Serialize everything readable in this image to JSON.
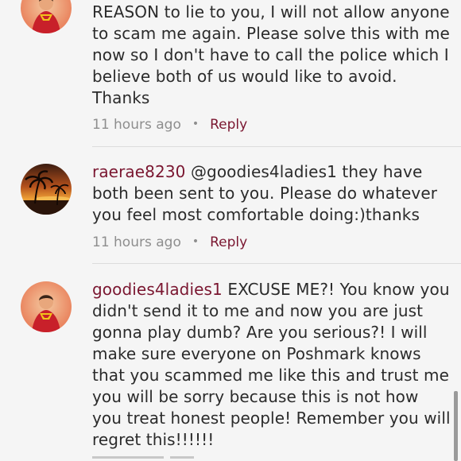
{
  "comments": [
    {
      "username": "",
      "text": "REASON to lie to you, I will not allow anyone to scam me again. Please solve this with me now so I don't have to call the police which I believe both of us would like to avoid. Thanks",
      "time": "11 hours ago",
      "reply_label": "Reply",
      "avatar_icon": "superman-avatar-icon"
    },
    {
      "username": "raerae8230",
      "text": "@goodies4ladies1 they have both been sent to you.  Please do whatever you feel most comfortable doing:)thanks",
      "time": "11 hours ago",
      "reply_label": "Reply",
      "avatar_icon": "sunset-palm-avatar-icon"
    },
    {
      "username": "goodies4ladies1",
      "text": "EXCUSE ME?! You know you didn't send it to me and now you are just gonna play dumb? Are you serious?! I will make sure everyone on Poshmark knows that you scammed me like this and trust me you will be sorry because this is not how you treat honest people! Remember you will regret this!!!!!!",
      "time": "",
      "reply_label": "",
      "avatar_icon": "superman-avatar-icon"
    }
  ],
  "colors": {
    "username": "#7a1630",
    "text": "#2b2b2b",
    "meta": "#8e8e8e",
    "background": "#f5f5f5"
  },
  "meta_separator": "•"
}
